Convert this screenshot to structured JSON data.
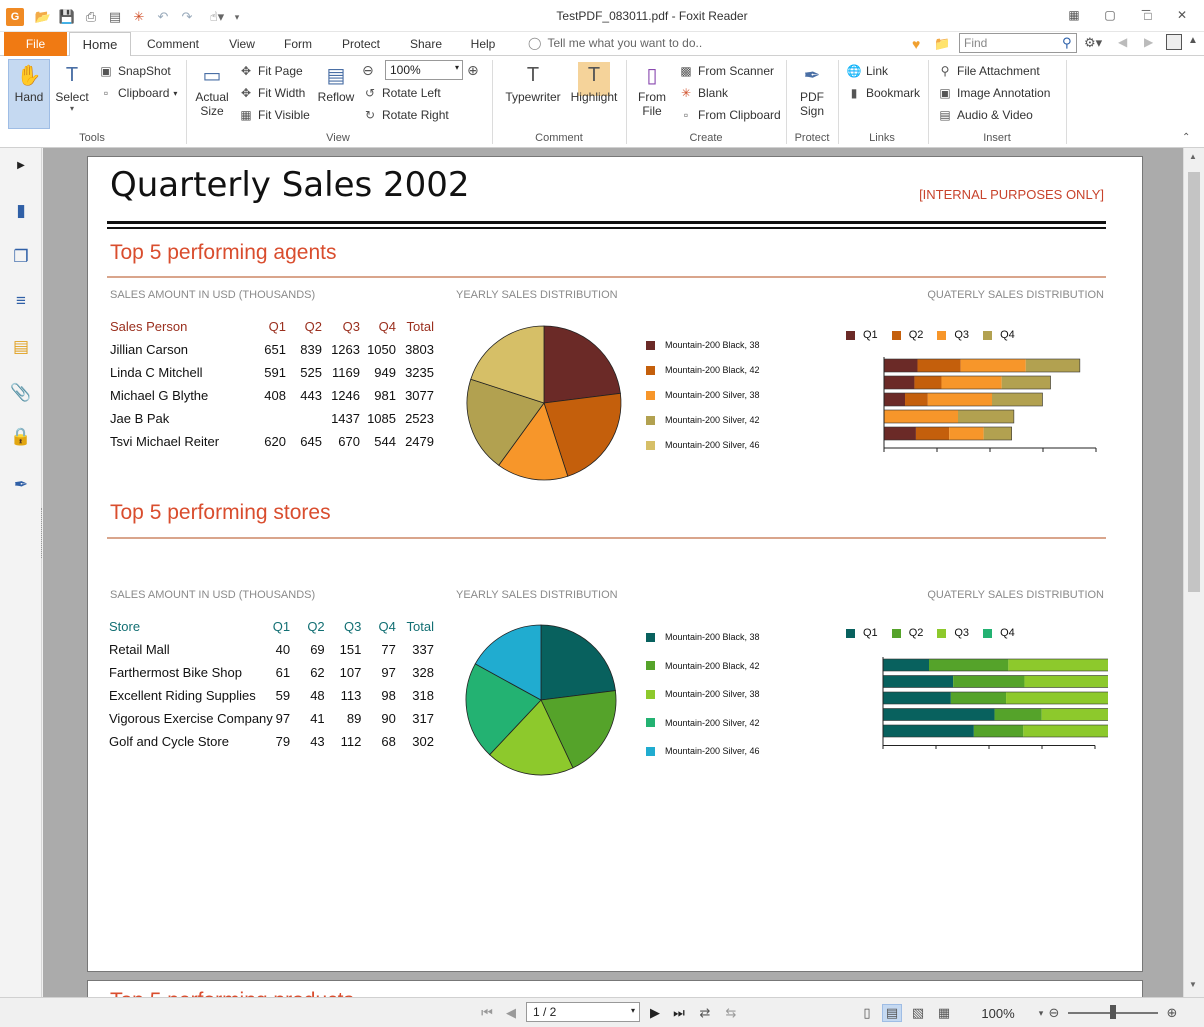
{
  "window": {
    "title": "TestPDF_083011.pdf - Foxit Reader",
    "find_placeholder": "Find"
  },
  "menu_tabs": [
    "File",
    "Home",
    "Comment",
    "View",
    "Form",
    "Protect",
    "Share",
    "Help"
  ],
  "tell_me": "Tell me what you want to do..",
  "ribbon": {
    "tools": {
      "hand": "Hand",
      "select": "Select",
      "snapshot": "SnapShot",
      "clipboard": "Clipboard",
      "label": "Tools"
    },
    "view": {
      "actual_size_1": "Actual",
      "actual_size_2": "Size",
      "fit_page": "Fit Page",
      "fit_width": "Fit Width",
      "fit_visible": "Fit Visible",
      "reflow": "Reflow",
      "zoom": "100%",
      "rotate_left": "Rotate Left",
      "rotate_right": "Rotate Right",
      "label": "View"
    },
    "comment": {
      "typewriter": "Typewriter",
      "highlight": "Highlight",
      "label": "Comment"
    },
    "create": {
      "from_file_1": "From",
      "from_file_2": "File",
      "from_scanner": "From Scanner",
      "blank": "Blank",
      "from_clipboard": "From Clipboard",
      "label": "Create"
    },
    "protect": {
      "pdf_sign_1": "PDF",
      "pdf_sign_2": "Sign",
      "label": "Protect"
    },
    "links": {
      "link": "Link",
      "bookmark": "Bookmark",
      "label": "Links"
    },
    "insert": {
      "file_attachment": "File Attachment",
      "image_annotation": "Image Annotation",
      "audio_video": "Audio & Video",
      "label": "Insert"
    }
  },
  "doc": {
    "title": "Quarterly Sales 2002",
    "internal": "[INTERNAL PURPOSES ONLY]",
    "section1": {
      "title": "Top 5 performing agents",
      "cap_amount": "SALES AMOUNT IN USD (THOUSANDS)",
      "cap_yearly": "YEARLY SALES DISTRIBUTION",
      "cap_quarterly": "QUATERLY SALES DISTRIBUTION",
      "headers": [
        "Sales Person",
        "Q1",
        "Q2",
        "Q3",
        "Q4",
        "Total"
      ],
      "rows": [
        [
          "Jillian  Carson",
          "651",
          "839",
          "1263",
          "1050",
          "3803"
        ],
        [
          "Linda C Mitchell",
          "591",
          "525",
          "1169",
          "949",
          "3235"
        ],
        [
          "Michael G Blythe",
          "408",
          "443",
          "1246",
          "981",
          "3077"
        ],
        [
          "Jae B Pak",
          "",
          "",
          "1437",
          "1085",
          "2523"
        ],
        [
          "Tsvi Michael Reiter",
          "620",
          "645",
          "670",
          "544",
          "2479"
        ]
      ]
    },
    "section2": {
      "title": "Top 5 performing stores",
      "cap_amount": "SALES AMOUNT IN USD (THOUSANDS)",
      "cap_yearly": "YEARLY SALES DISTRIBUTION",
      "cap_quarterly": "QUATERLY SALES DISTRIBUTION",
      "headers": [
        "Store",
        "Q1",
        "Q2",
        "Q3",
        "Q4",
        "Total"
      ],
      "rows": [
        [
          "Retail Mall",
          "40",
          "69",
          "151",
          "77",
          "337"
        ],
        [
          "Farthermost Bike Shop",
          "61",
          "62",
          "107",
          "97",
          "328"
        ],
        [
          "Excellent Riding Supplies",
          "59",
          "48",
          "113",
          "98",
          "318"
        ],
        [
          "Vigorous Exercise Company",
          "97",
          "41",
          "89",
          "90",
          "317"
        ],
        [
          "Golf and Cycle Store",
          "79",
          "43",
          "112",
          "68",
          "302"
        ]
      ]
    },
    "page2_peek": "Top 5 performing products"
  },
  "chart_data": [
    {
      "type": "pie",
      "title": "YEARLY SALES DISTRIBUTION",
      "labels": [
        "Mountain-200 Black, 38",
        "Mountain-200 Black, 42",
        "Mountain-200 Silver, 38",
        "Mountain-200 Silver, 42",
        "Mountain-200 Silver, 46"
      ],
      "values": [
        23,
        22,
        15,
        20,
        20
      ],
      "colors": [
        "#6b2a27",
        "#c45f0c",
        "#f7962a",
        "#b2a150",
        "#d6bf67"
      ]
    },
    {
      "type": "bar",
      "orientation": "horizontal",
      "stacked": true,
      "title": "QUATERLY SALES DISTRIBUTION",
      "categories": [
        "Jillian  Carson",
        "Linda C Mitchell",
        "Michael G Blythe",
        "Jae B Pak",
        "Tsvi Michael Reiter"
      ],
      "series": [
        {
          "name": "Q1",
          "values": [
            651,
            591,
            408,
            0,
            620
          ],
          "color": "#6b2a27"
        },
        {
          "name": "Q2",
          "values": [
            839,
            525,
            443,
            0,
            645
          ],
          "color": "#c45f0c"
        },
        {
          "name": "Q3",
          "values": [
            1263,
            1169,
            1246,
            1437,
            670
          ],
          "color": "#f7962a"
        },
        {
          "name": "Q4",
          "values": [
            1050,
            949,
            981,
            1085,
            544
          ],
          "color": "#b2a150"
        }
      ],
      "xlim": [
        0,
        4000
      ]
    },
    {
      "type": "pie",
      "title": "YEARLY SALES DISTRIBUTION",
      "labels": [
        "Mountain-200 Black, 38",
        "Mountain-200 Black, 42",
        "Mountain-200 Silver, 38",
        "Mountain-200 Silver, 42",
        "Mountain-200 Silver, 46"
      ],
      "values": [
        23,
        20,
        19,
        21,
        17
      ],
      "colors": [
        "#08615e",
        "#55a32a",
        "#8dc92c",
        "#23b272",
        "#20acd0"
      ]
    },
    {
      "type": "bar",
      "orientation": "horizontal",
      "stacked": true,
      "title": "QUATERLY SALES DISTRIBUTION",
      "categories": [
        "Retail Mall",
        "Farthermost Bike Shop",
        "Excellent Riding Supplies",
        "Vigorous Exercise Company",
        "Golf and Cycle Store"
      ],
      "series": [
        {
          "name": "Q1",
          "values": [
            40,
            61,
            59,
            97,
            79
          ],
          "color": "#08615e"
        },
        {
          "name": "Q2",
          "values": [
            69,
            62,
            48,
            41,
            43
          ],
          "color": "#55a32a"
        },
        {
          "name": "Q3",
          "values": [
            151,
            107,
            113,
            89,
            112
          ],
          "color": "#8dc92c"
        },
        {
          "name": "Q4",
          "values": [
            77,
            97,
            98,
            90,
            68
          ],
          "color": "#23b272"
        }
      ],
      "xlim": [
        0,
        400
      ]
    }
  ],
  "statusbar": {
    "page": "1 / 2",
    "zoom": "100%"
  }
}
